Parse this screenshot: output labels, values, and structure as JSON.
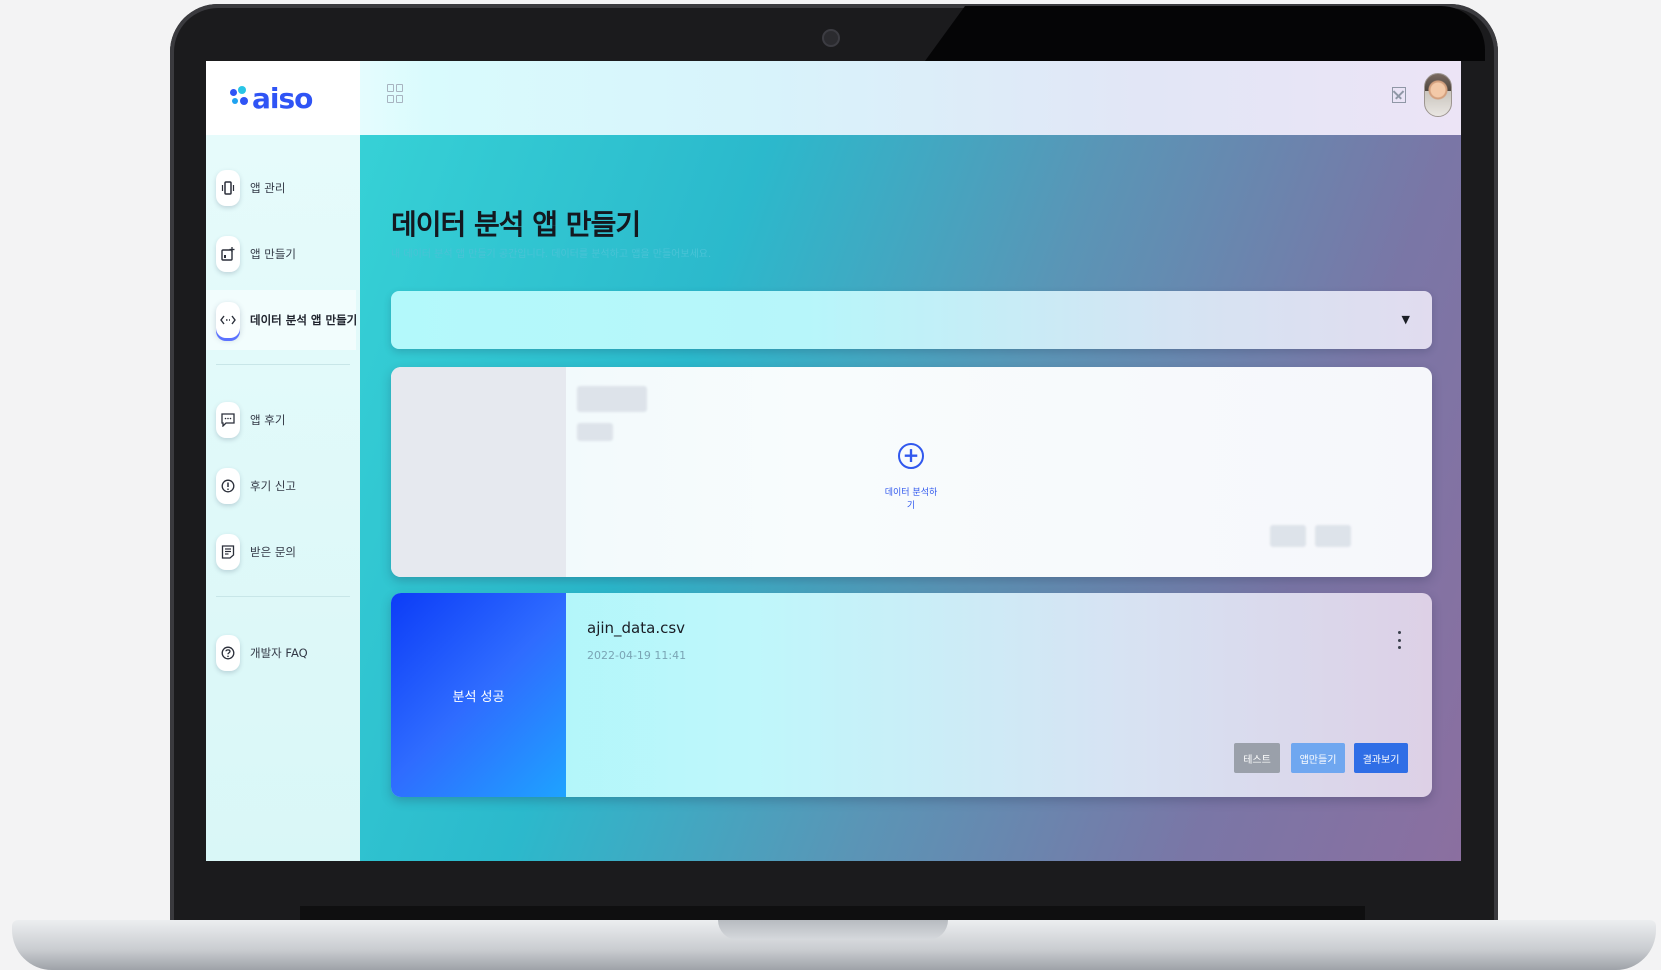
{
  "app": {
    "logo_text": "aiso"
  },
  "header": {
    "avatar": "user-avatar"
  },
  "sidebar": {
    "items": [
      {
        "label": "앱 관리",
        "icon": "phone-vibrate-icon"
      },
      {
        "label": "앱 만들기",
        "icon": "add-app-icon"
      },
      {
        "label": "데이터 분석 앱 만들기",
        "icon": "code-icon"
      },
      {
        "label": "앱 후기",
        "icon": "chat-bubble-icon"
      },
      {
        "label": "후기 신고",
        "icon": "alert-circle-icon"
      },
      {
        "label": "받은 문의",
        "icon": "document-icon"
      },
      {
        "label": "개발자 FAQ",
        "icon": "help-circle-icon"
      }
    ],
    "active_index": 2
  },
  "main": {
    "title": "데이터 분석 앱 만들기",
    "subtitle": "내 데이터 분석 앱 만들기 공간입니다. 데이터를 분석하고 앱을 만들어보세요.",
    "new_card": {
      "label": "데이터 분석하기",
      "icon": "plus-circle-icon"
    },
    "result_card": {
      "status": "분석 성공",
      "file_name": "ajin_data.csv",
      "date": "2022-04-19 11:41",
      "buttons": {
        "test": "테스트",
        "make": "앱만들기",
        "view": "결과보기"
      }
    }
  },
  "colors": {
    "accent": "#3158ee",
    "main_gradient_start": "#36d1d6",
    "main_gradient_end": "#8b6fa0"
  }
}
